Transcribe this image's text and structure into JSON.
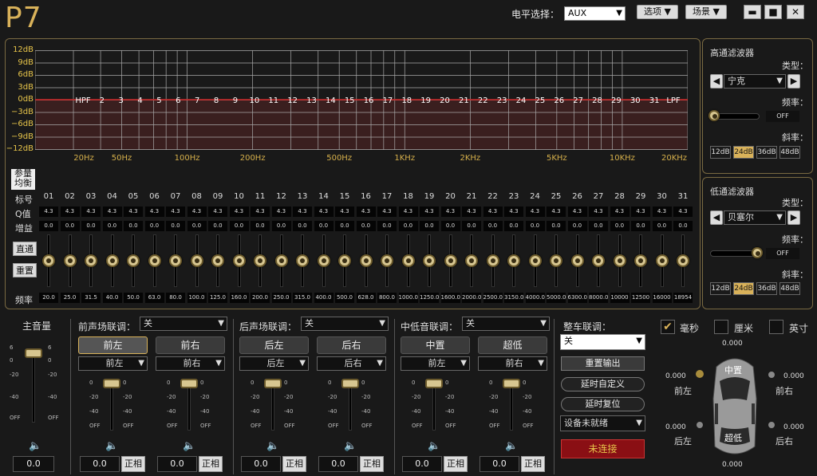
{
  "app": {
    "logo": "P7",
    "level_label": "电平选择：",
    "level_value": "AUX",
    "options_label": "选项",
    "scene_label": "场景",
    "min": "▬",
    "max": "■",
    "close": "✕"
  },
  "eq": {
    "y_ticks": [
      "12dB",
      "9dB",
      "6dB",
      "3dB",
      "0dB",
      "−3dB",
      "−6dB",
      "−9dB",
      "−12dB"
    ],
    "band_markers": [
      "HPF",
      "2",
      "3",
      "4",
      "5",
      "6",
      "7",
      "8",
      "9",
      "10",
      "11",
      "12",
      "13",
      "14",
      "15",
      "16",
      "17",
      "18",
      "19",
      "20",
      "21",
      "22",
      "23",
      "24",
      "25",
      "26",
      "27",
      "28",
      "29",
      "30",
      "31",
      "LPF"
    ],
    "x_labels": [
      "20Hz",
      "50Hz",
      "100Hz",
      "200Hz",
      "500Hz",
      "1KHz",
      "2KHz",
      "5KHz",
      "10KHz",
      "20KHz"
    ],
    "row_labels": {
      "param": "参量均衡",
      "index": "标号",
      "q": "Q值",
      "gain": "增益",
      "freq": "频率"
    },
    "side_buttons": {
      "bypass": "直通",
      "reset": "重置"
    },
    "bands": [
      "01",
      "02",
      "03",
      "04",
      "05",
      "06",
      "07",
      "08",
      "09",
      "10",
      "11",
      "12",
      "13",
      "14",
      "15",
      "16",
      "17",
      "18",
      "19",
      "20",
      "21",
      "22",
      "23",
      "24",
      "25",
      "26",
      "27",
      "28",
      "29",
      "30",
      "31"
    ],
    "q_values": [
      "4.3",
      "4.3",
      "4.3",
      "4.3",
      "4.3",
      "4.3",
      "4.3",
      "4.3",
      "4.3",
      "4.3",
      "4.3",
      "4.3",
      "4.3",
      "4.3",
      "4.3",
      "4.3",
      "4.3",
      "4.3",
      "4.3",
      "4.3",
      "4.3",
      "4.3",
      "4.3",
      "4.3",
      "4.3",
      "4.3",
      "4.3",
      "4.3",
      "4.3",
      "4.3",
      "4.3"
    ],
    "gain_values": [
      "0.0",
      "0.0",
      "0.0",
      "0.0",
      "0.0",
      "0.0",
      "0.0",
      "0.0",
      "0.0",
      "0.0",
      "0.0",
      "0.0",
      "0.0",
      "0.0",
      "0.0",
      "0.0",
      "0.0",
      "0.0",
      "0.0",
      "0.0",
      "0.0",
      "0.0",
      "0.0",
      "0.0",
      "0.0",
      "0.0",
      "0.0",
      "0.0",
      "0.0",
      "0.0",
      "0.0"
    ],
    "freq_values": [
      "20.0",
      "25.0",
      "31.5",
      "40.0",
      "50.0",
      "63.0",
      "80.0",
      "100.0",
      "125.0",
      "160.0",
      "200.0",
      "250.0",
      "315.0",
      "400.0",
      "500.0",
      "628.0",
      "800.0",
      "1000.0",
      "1250.0",
      "1600.0",
      "2000.0",
      "2500.0",
      "3150.0",
      "4000.0",
      "5000.0",
      "6300.0",
      "8000.0",
      "10000",
      "12500",
      "16000",
      "18954"
    ]
  },
  "hpf": {
    "title": "高通滤波器",
    "type_label": "类型：",
    "type_value": "宁克",
    "freq_label": "频率：",
    "freq_value": "OFF",
    "slope_label": "斜率：",
    "slopes": [
      "12dB",
      "24dB",
      "36dB",
      "48dB"
    ],
    "active_slope": "24dB"
  },
  "lpf": {
    "title": "低通滤波器",
    "type_label": "类型：",
    "type_value": "贝塞尔",
    "freq_label": "频率：",
    "freq_value": "OFF",
    "slope_label": "斜率：",
    "slopes": [
      "12dB",
      "24dB",
      "36dB",
      "48dB"
    ],
    "active_slope": "24dB"
  },
  "master": {
    "title": "主音量",
    "value": "0.0",
    "scale": [
      "6",
      "0",
      "-20",
      "-40",
      "OFF"
    ]
  },
  "groups": [
    {
      "title": "前声场联调：",
      "link": "关",
      "channels": [
        {
          "name": "前左",
          "sel": "前左",
          "value": "0.0",
          "phase": "正相"
        },
        {
          "name": "前右",
          "sel": "前右",
          "value": "0.0",
          "phase": "正相"
        }
      ]
    },
    {
      "title": "后声场联调：",
      "link": "关",
      "channels": [
        {
          "name": "后左",
          "sel": "后左",
          "value": "0.0",
          "phase": "正相"
        },
        {
          "name": "后右",
          "sel": "后右",
          "value": "0.0",
          "phase": "正相"
        }
      ]
    },
    {
      "title": "中低音联调：",
      "link": "关",
      "channels": [
        {
          "name": "中置",
          "sel": "前左",
          "value": "0.0",
          "phase": "正相"
        },
        {
          "name": "超低",
          "sel": "前右",
          "value": "0.0",
          "phase": "正相"
        }
      ]
    }
  ],
  "fader_scale": [
    "0",
    "-20",
    "-40",
    "OFF"
  ],
  "car": {
    "title": "整车联调：",
    "link": "关",
    "reset_output": "重置输出",
    "delay_custom": "延时自定义",
    "delay_reset": "延时复位",
    "device": "设备未就绪",
    "connect": "未连接"
  },
  "units": {
    "ms": "毫秒",
    "cm": "厘米",
    "inch": "英寸"
  },
  "delays": {
    "top": "0.000",
    "bottom": "0.000",
    "fl": "0.000",
    "fr": "0.000",
    "rl": "0.000",
    "rr": "0.000"
  },
  "car_labels": {
    "fl": "前左",
    "fr": "前右",
    "rl": "后左",
    "rr": "后右",
    "center": "中置",
    "sub": "超低"
  }
}
